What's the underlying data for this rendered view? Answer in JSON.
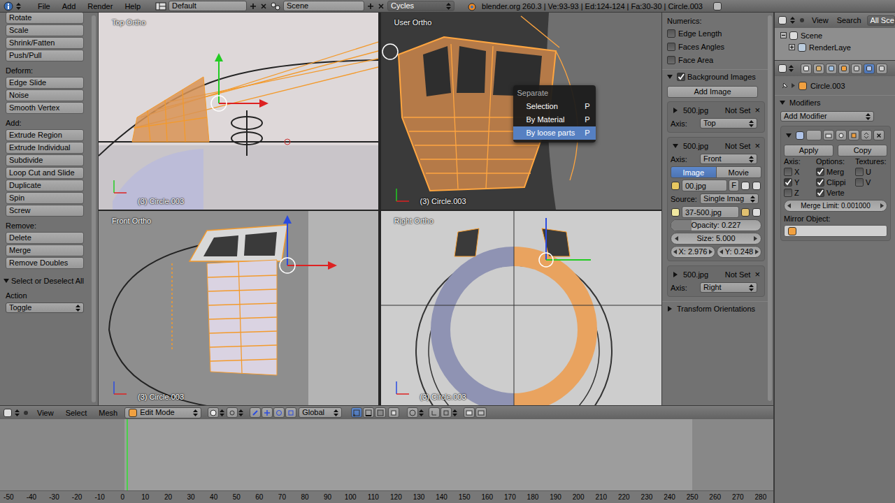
{
  "topbar": {
    "menus": [
      "File",
      "Add",
      "Render",
      "Help"
    ],
    "layout": "Default",
    "scene": "Scene",
    "engine": "Cycles",
    "stats": "blender.org 260.3 | Ve:93-93 | Ed:124-124 | Fa:30-30 | Circle.003"
  },
  "tool_shelf": {
    "items": [
      {
        "kind": "button",
        "label": "Rotate"
      },
      {
        "kind": "button",
        "label": "Scale"
      },
      {
        "kind": "button",
        "label": "Shrink/Fatten"
      },
      {
        "kind": "button",
        "label": "Push/Pull"
      },
      {
        "kind": "heading",
        "label": "Deform:"
      },
      {
        "kind": "button",
        "label": "Edge Slide"
      },
      {
        "kind": "button",
        "label": "Noise"
      },
      {
        "kind": "button",
        "label": "Smooth Vertex"
      },
      {
        "kind": "heading",
        "label": "Add:"
      },
      {
        "kind": "button",
        "label": "Extrude Region"
      },
      {
        "kind": "button",
        "label": "Extrude Individual"
      },
      {
        "kind": "button",
        "label": "Subdivide"
      },
      {
        "kind": "button",
        "label": "Loop Cut and Slide"
      },
      {
        "kind": "button",
        "label": "Duplicate"
      },
      {
        "kind": "button",
        "label": "Spin"
      },
      {
        "kind": "button",
        "label": "Screw"
      },
      {
        "kind": "heading",
        "label": "Remove:"
      },
      {
        "kind": "button",
        "label": "Delete"
      },
      {
        "kind": "button",
        "label": "Merge"
      },
      {
        "kind": "button",
        "label": "Remove Doubles"
      }
    ],
    "operator": {
      "title": "Select or Deselect All",
      "expanded": true,
      "field_label": "Action",
      "value": "Toggle"
    }
  },
  "viewports": [
    {
      "view": "Top Ortho",
      "object": "(3) Circle.003"
    },
    {
      "view": "User Ortho",
      "object": "(3) Circle.003"
    },
    {
      "view": "Front Ortho",
      "object": "(3) Circle.003"
    },
    {
      "view": "Right Ortho",
      "object": "(3) Circle.003"
    }
  ],
  "context_menu": {
    "title": "Separate",
    "items": [
      {
        "label": "Selection",
        "shortcut": "P",
        "selected": false
      },
      {
        "label": "By Material",
        "shortcut": "P",
        "selected": false
      },
      {
        "label": "By loose parts",
        "shortcut": "P",
        "selected": true
      }
    ]
  },
  "n_panel": {
    "numerics": {
      "label": "Numerics:",
      "options": [
        {
          "label": "Edge Length",
          "checked": false
        },
        {
          "label": "Faces Angles",
          "checked": false
        },
        {
          "label": "Face Area",
          "checked": false
        }
      ]
    },
    "background_images": {
      "label": "Background Images",
      "expanded": true,
      "checked": true,
      "add_label": "Add Image",
      "images": [
        {
          "name": "500.jpg",
          "status": "Not Set",
          "close": "×",
          "expanded": false,
          "axis_label": "Axis:",
          "axis": "Top"
        },
        {
          "name": "500.jpg",
          "status": "Not Set",
          "close": "×",
          "expanded": true,
          "axis_label": "Axis:",
          "axis": "Front",
          "source_tabs": [
            {
              "label": "Image",
              "selected": true
            },
            {
              "label": "Movie",
              "selected": false
            }
          ],
          "file": "00.jpg",
          "file_flag": "F",
          "source_label": "Source:",
          "source": "Single Imag",
          "image_file": "37-500.jpg",
          "opacity": {
            "label": "Opacity: 0.227",
            "level": 0.227
          },
          "size": "Size: 5.000",
          "offset_x": "X: 2.976",
          "offset_y": "Y: 0.248"
        },
        {
          "name": "500.jpg",
          "status": "Not Set",
          "close": "×",
          "expanded": false,
          "axis_label": "Axis:",
          "axis": "Right"
        }
      ]
    },
    "transform_orientations": {
      "label": "Transform Orientations",
      "expanded": false
    }
  },
  "outliner": {
    "menus": [
      "View",
      "Search"
    ],
    "filter": "All Sce",
    "tree": [
      {
        "label": "Scene",
        "expanded": true
      },
      {
        "label": "RenderLaye",
        "expanded": false
      }
    ]
  },
  "properties": {
    "context_tabs": [
      {
        "selected": false
      },
      {
        "selected": false
      },
      {
        "selected": false
      },
      {
        "selected": false
      },
      {
        "selected": false
      },
      {
        "selected": true
      },
      {
        "selected": false
      }
    ],
    "breadcrumb": "Circle.003",
    "modifiers_panel": {
      "label": "Modifiers",
      "expanded": true
    },
    "add_modifier": "Add Modifier",
    "mirror": {
      "expanded": true,
      "apply": "Apply",
      "copy": "Copy",
      "axis_label": "Axis:",
      "options_label": "Options:",
      "textures_label": "Textures:",
      "axes": [
        {
          "label": "X",
          "checked": false
        },
        {
          "label": "Y",
          "checked": true
        },
        {
          "label": "Z",
          "checked": false
        }
      ],
      "options": [
        {
          "label": "Merg",
          "checked": true
        },
        {
          "label": "Clippi",
          "checked": true
        },
        {
          "label": "Verte",
          "checked": true
        }
      ],
      "textures": [
        {
          "label": "U",
          "checked": false
        },
        {
          "label": "V",
          "checked": false
        }
      ],
      "merge_limit": "Merge Limit: 0.001000",
      "mirror_object_label": "Mirror Object:"
    }
  },
  "view3d_header": {
    "menus": [
      "View",
      "Select",
      "Mesh"
    ],
    "mode": "Edit Mode",
    "orientation": "Global",
    "select_modes": [
      {
        "selected": true
      },
      {
        "selected": false
      },
      {
        "selected": false
      }
    ]
  },
  "timeline": {
    "ticks": [
      "-50",
      "-40",
      "-30",
      "-20",
      "-10",
      "0",
      "10",
      "20",
      "30",
      "40",
      "50",
      "60",
      "70",
      "80",
      "90",
      "100",
      "110",
      "120",
      "130",
      "140",
      "150",
      "160",
      "170",
      "180",
      "190",
      "200",
      "210",
      "220",
      "230",
      "240",
      "250",
      "260",
      "270",
      "280"
    ]
  }
}
